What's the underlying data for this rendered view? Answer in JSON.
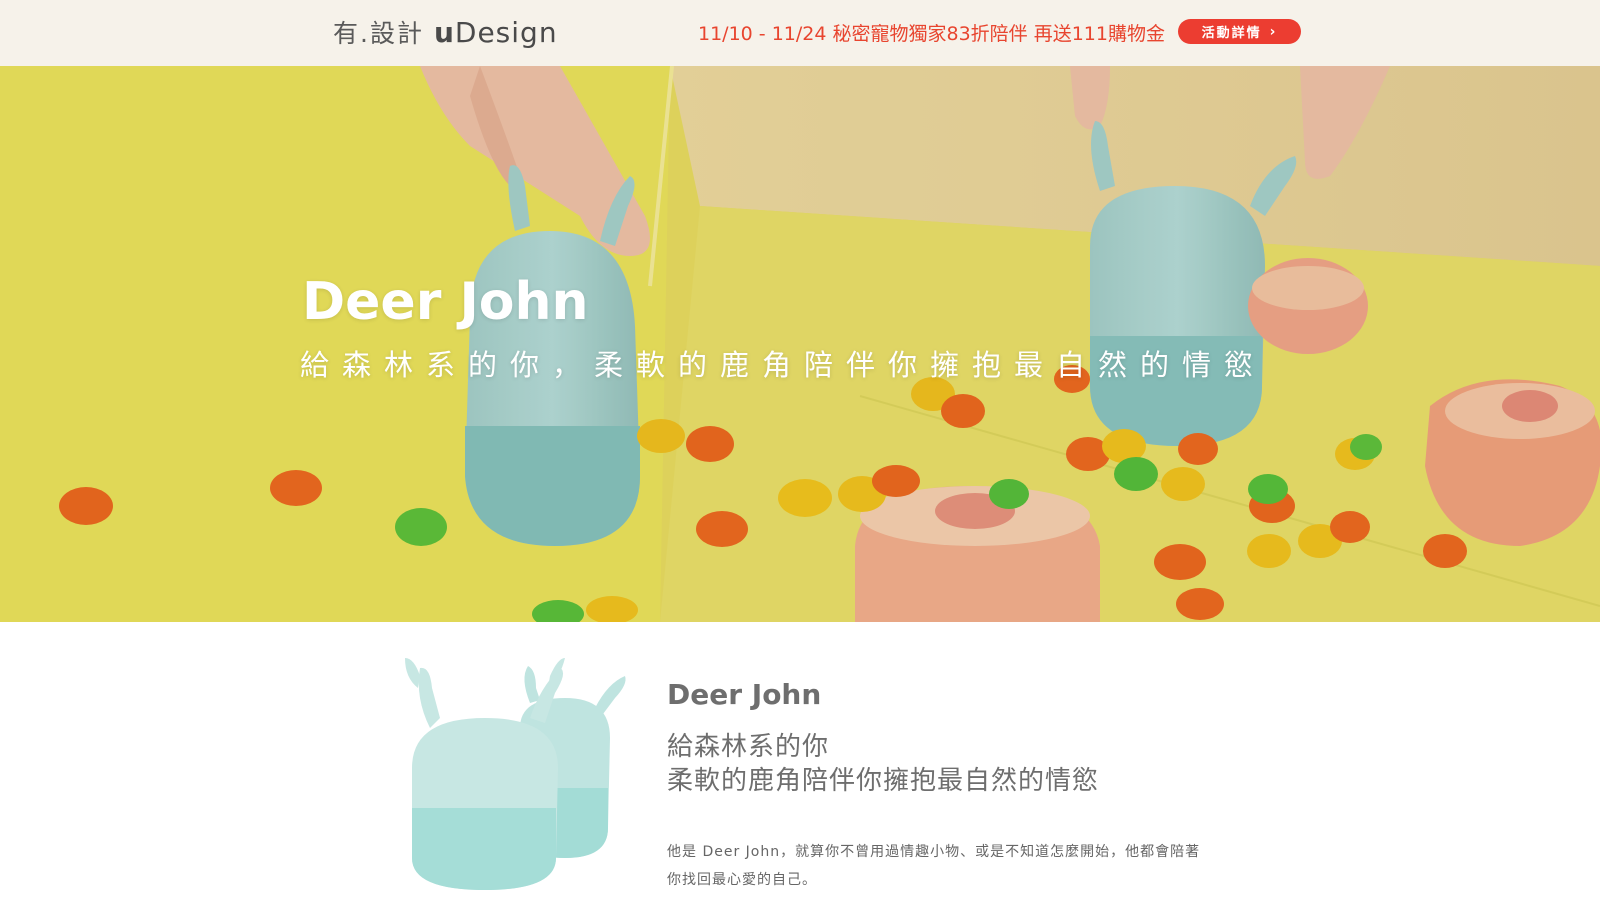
{
  "header": {
    "brand_cn": "有.設計",
    "brand_en_bold": "u",
    "brand_en_rest": "Design",
    "promo_text": "11/10 - 11/24 秘密寵物獨家83折陪伴  再送111購物金",
    "promo_button": "活動詳情",
    "promo_button_icon": "chevron-right-icon"
  },
  "hero": {
    "title": "Deer John",
    "subtitle": "給森林系的你，柔軟的鹿角陪伴你擁抱最自然的情慾"
  },
  "product": {
    "title": "Deer John",
    "line1": "給森林系的你",
    "line2": "柔軟的鹿角陪伴你擁抱最自然的情慾",
    "description": "他是 Deer John，就算你不曾用過情趣小物、或是不知道怎麼開始，他都會陪著你找回最心愛的自己。"
  },
  "colors": {
    "accent": "#ec3d31",
    "promo_text": "#e8452f",
    "header_bg": "#f6f2ea",
    "hero_yellow": "#ece35b",
    "product_mint": "#a9dcd6"
  }
}
